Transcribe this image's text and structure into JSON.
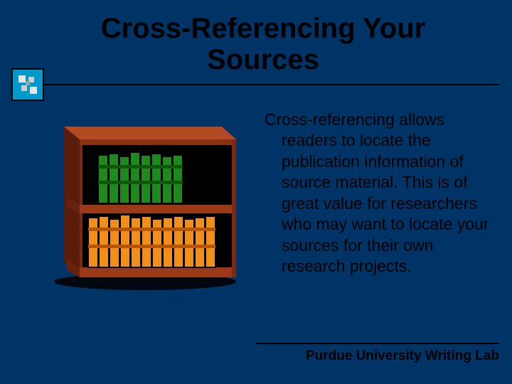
{
  "title": "Cross-Referencing Your Sources",
  "body_first": "Cross-referencing allows",
  "body_rest": "readers to locate the publication information of source material.  This is of great value for researchers who may want to locate your sources for their own research projects.",
  "footer": "Purdue University Writing Lab"
}
